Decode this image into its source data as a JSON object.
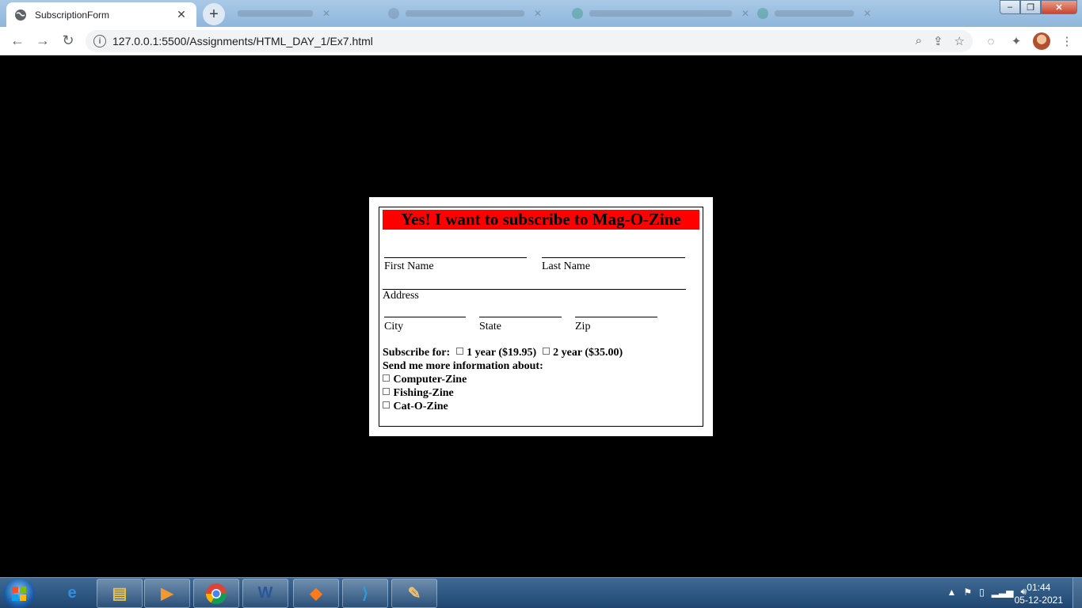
{
  "browser": {
    "tab_title": "SubscriptionForm",
    "tab_close": "✕",
    "new_tab": "+",
    "url": "127.0.0.1:5500/Assignments/HTML_DAY_1/Ex7.html"
  },
  "form": {
    "banner": "Yes! I want to subscribe to Mag-O-Zine",
    "first_name_label": "First Name",
    "last_name_label": "Last Name",
    "address_label": "Address",
    "city_label": "City",
    "state_label": "State",
    "zip_label": "Zip",
    "subscribe_label": "Subscribe for:",
    "option_1year": "1 year ($19.95)",
    "option_2year": "2 year ($35.00)",
    "more_info_label": "Send me more information about:",
    "zines": [
      "Computer-Zine",
      "Fishing-Zine",
      "Cat-O-Zine"
    ]
  },
  "taskbar": {
    "time": "01:44",
    "date": "05-12-2021"
  },
  "colors": {
    "banner_bg": "#ff0000",
    "page_bg": "#000000"
  }
}
